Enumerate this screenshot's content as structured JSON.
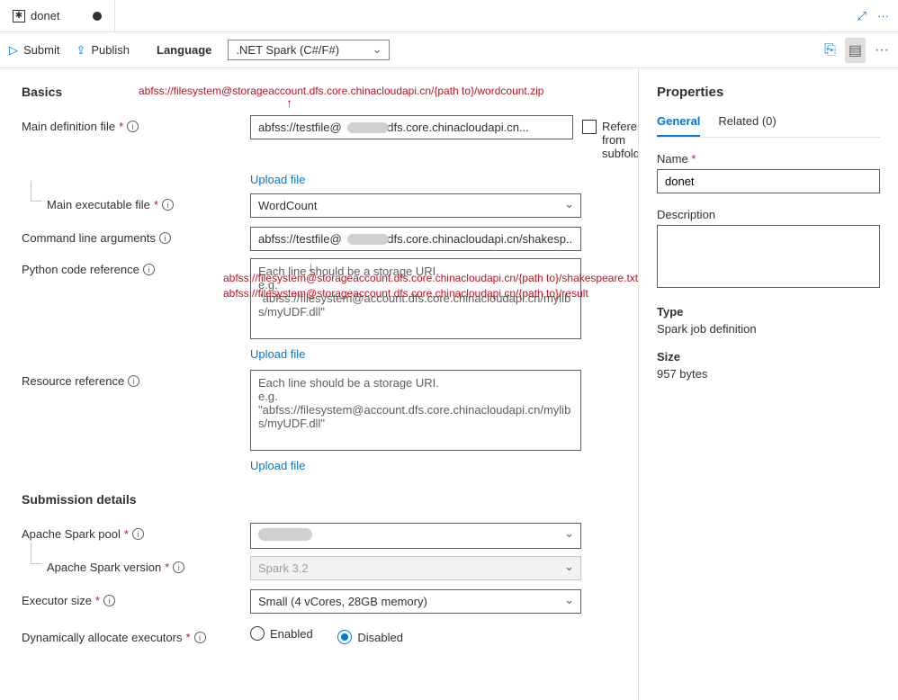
{
  "tab": {
    "title": "donet"
  },
  "actionbar": {
    "submit": "Submit",
    "publish": "Publish",
    "language_label": "Language",
    "language_value": ".NET Spark (C#/F#)"
  },
  "annotations": {
    "top": "abfss://filesystem@storageaccount.dfs.core.chinacloudapi.cn/{path to}/wordcount.zip",
    "mid1": "abfss://filesystem@storageaccount.dfs.core.chinacloudapi.cn/{path to}/shakespeare.txt",
    "mid2": "abfss://filesystem@storageaccount.dfs.core.chinacloudapi.cn/{path to}/result"
  },
  "basics": {
    "section": "Basics",
    "main_def_label": "Main definition file",
    "main_def_value": "abfss://testfile@             .dfs.core.chinacloudapi.cn...",
    "referenced_label": "Referenced from subfolder",
    "upload": "Upload file",
    "main_exec_label": "Main executable file",
    "main_exec_value": "WordCount",
    "cmdline_label": "Command line arguments",
    "cmdline_value": "abfss://testfile@             .dfs.core.chinacloudapi.cn/shakesp...",
    "pycode_label": "Python code reference",
    "pycode_placeholder": "Each line should be a storage URI.\ne.g. \"abfss://filesystem@account.dfs.core.chinacloudapi.cn/mylibs/myUDF.dll\"",
    "resref_label": "Resource reference",
    "resref_placeholder": "Each line should be a storage URI.\ne.g. \"abfss://filesystem@account.dfs.core.chinacloudapi.cn/mylibs/myUDF.dll\""
  },
  "submission": {
    "section": "Submission details",
    "pool_label": "Apache Spark pool",
    "version_label": "Apache Spark version",
    "version_value": "Spark 3.2",
    "execsize_label": "Executor size",
    "execsize_value": "Small (4 vCores, 28GB memory)",
    "dynalloc_label": "Dynamically allocate executors",
    "enabled": "Enabled",
    "disabled": "Disabled"
  },
  "properties": {
    "title": "Properties",
    "tab_general": "General",
    "tab_related": "Related (0)",
    "name_label": "Name",
    "name_value": "donet",
    "desc_label": "Description",
    "type_label": "Type",
    "type_value": "Spark job definition",
    "size_label": "Size",
    "size_value": "957 bytes"
  }
}
